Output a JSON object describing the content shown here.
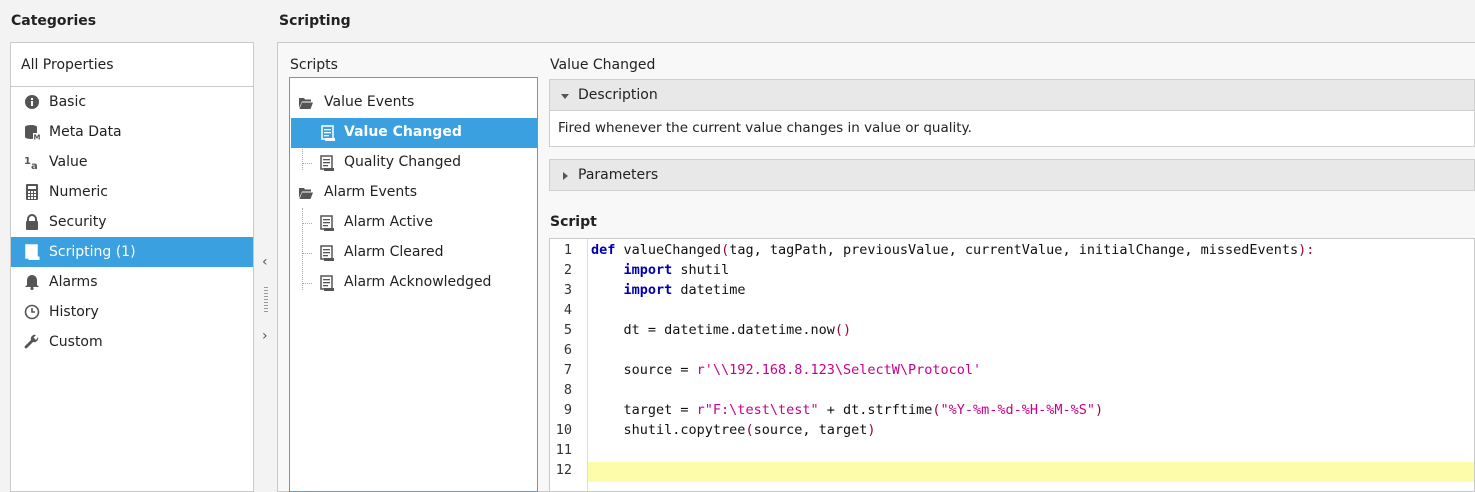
{
  "categories": {
    "header": "Categories",
    "all_properties": "All Properties",
    "items": [
      {
        "label": "Basic",
        "icon": "info-icon"
      },
      {
        "label": "Meta Data",
        "icon": "database-icon"
      },
      {
        "label": "Value",
        "icon": "value-icon"
      },
      {
        "label": "Numeric",
        "icon": "calculator-icon"
      },
      {
        "label": "Security",
        "icon": "lock-icon"
      },
      {
        "label": "Scripting (1)",
        "icon": "script-icon",
        "selected": true
      },
      {
        "label": "Alarms",
        "icon": "bell-icon"
      },
      {
        "label": "History",
        "icon": "clock-icon"
      },
      {
        "label": "Custom",
        "icon": "wrench-icon"
      }
    ]
  },
  "scripting": {
    "header": "Scripting",
    "scripts_label": "Scripts",
    "tree": {
      "value_events": "Value Events",
      "value_changed": "Value Changed",
      "quality_changed": "Quality Changed",
      "alarm_events": "Alarm Events",
      "alarm_active": "Alarm Active",
      "alarm_cleared": "Alarm Cleared",
      "alarm_acknowledged": "Alarm Acknowledged"
    },
    "detail": {
      "title": "Value Changed",
      "description_label": "Description",
      "description_text": "Fired whenever the current value changes in value or quality.",
      "parameters_label": "Parameters",
      "script_label": "Script"
    },
    "code": {
      "line_numbers": [
        "1",
        "2",
        "3",
        "4",
        "5",
        "6",
        "7",
        "8",
        "9",
        "10",
        "11",
        "12"
      ],
      "l1_def": "def",
      "l1_rest": " valueChanged",
      "l1_open": "(",
      "l1_args": "tag, tagPath, previousValue, currentValue, initialChange, missedEvents",
      "l1_close": "):",
      "l2_import": "import",
      "l2_mod": " shutil",
      "l3_import": "import",
      "l3_mod": " datetime",
      "l5_code": "dt = datetime.datetime.now",
      "l5_paren": "()",
      "l7_code": "source = ",
      "l7_str": "r'\\\\192.168.8.123\\SelectW\\Protocol'",
      "l9_code": "target = ",
      "l9_str1": "r\"F:\\test\\test\"",
      "l9_mid": " + dt.strftime",
      "l9_open": "(",
      "l9_str2": "\"%Y-%m-%d-%H-%M-%S\"",
      "l9_close": ")",
      "l10_code": "shutil.copytree",
      "l10_open": "(",
      "l10_args": "source, target",
      "l10_close": ")"
    }
  },
  "splitter": {
    "collapse_glyph": "‹",
    "expand_glyph": "›"
  },
  "colors": {
    "accent": "#3aa0df",
    "keyword": "#0000b0",
    "string": "#c8008c",
    "current_line": "#fdfcaa"
  }
}
